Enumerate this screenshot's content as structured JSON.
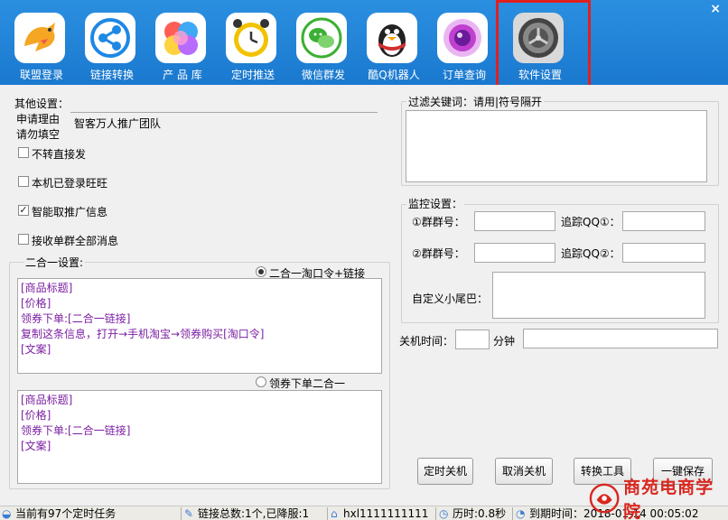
{
  "toolbar": {
    "close_glyph": "×",
    "buttons": [
      {
        "label": "联盟登录",
        "icon": "kangaroo-icon",
        "color": "#f5a623"
      },
      {
        "label": "链接转换",
        "icon": "share-icon",
        "color": "#1e88e5"
      },
      {
        "label": "产 品 库",
        "icon": "balloons-icon",
        "color": "#ff6fb0"
      },
      {
        "label": "定时推送",
        "icon": "alarm-clock-icon",
        "color": "#f2c200"
      },
      {
        "label": "微信群发",
        "icon": "wechat-icon",
        "color": "#3cb034"
      },
      {
        "label": "酷Q机器人",
        "icon": "penguin-icon",
        "color": "#d32f2f"
      },
      {
        "label": "订单查询",
        "icon": "camera-lens-icon",
        "color": "#c040d0"
      },
      {
        "label": "软件设置",
        "icon": "settings-icon",
        "color": "#555555"
      }
    ]
  },
  "other_settings": {
    "title": "其他设置：",
    "apply_reason_label_1": "申请理由",
    "apply_reason_label_2": "请勿填空",
    "apply_reason_value": "智客万人推广团队",
    "checkboxes": [
      {
        "label": "不转直接发",
        "checked": false
      },
      {
        "label": "本机已登录旺旺",
        "checked": false
      },
      {
        "label": "智能取推广信息",
        "checked": true
      },
      {
        "label": "接收单群全部消息",
        "checked": false
      }
    ]
  },
  "two_in_one": {
    "title": "二合一设置:",
    "option_1": "二合一淘口令+链接",
    "option_2": "领券下单二合一",
    "template_1": [
      "[商品标题]",
      "[价格]",
      "领券下单:[二合一链接]",
      "复制这条信息，打开→手机淘宝→领券购买[淘口令]",
      "[文案]"
    ],
    "template_2": [
      "[商品标题]",
      "[价格]",
      "领券下单:[二合一链接]",
      "[文案]"
    ]
  },
  "filter": {
    "title": "过滤关键词：请用|符号隔开"
  },
  "monitor": {
    "title": "监控设置：",
    "group1_label": "①群群号：",
    "track1_label": "追踪QQ①：",
    "group2_label": "②群群号：",
    "track2_label": "追踪QQ②：",
    "tail_label": "自定义小尾巴："
  },
  "shutdown": {
    "time_label": "关机时间：",
    "minutes_label": "分钟"
  },
  "buttons": {
    "timed_shutdown": "定时关机",
    "cancel_shutdown": "取消关机",
    "convert_tool": "转换工具",
    "one_click_save": "一键保存"
  },
  "status": {
    "tasks": "当前有97个定时任务",
    "links": "链接总数:1个,已降服:1",
    "user": "hxl1111111111",
    "elapsed": "历时:0.8秒",
    "expiry": "到期时间：2018-01-14 00:05:02"
  },
  "watermark": {
    "text": "商苑电商学院",
    "color": "#d8261f"
  },
  "colors": {
    "toolbar_blue": "#1f83d6",
    "highlight_red": "#e02020",
    "template_purple": "#7b1fa2"
  }
}
